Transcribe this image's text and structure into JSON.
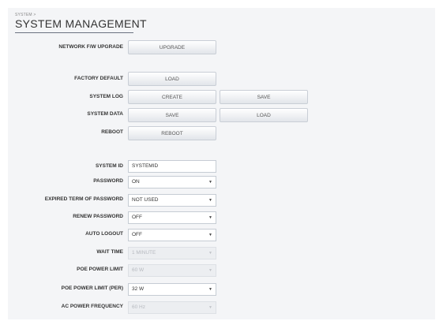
{
  "header": {
    "breadcrumb": "SYSTEM >",
    "title": "SYSTEM MANAGEMENT"
  },
  "actions": {
    "network_fw_upgrade": {
      "label": "NETWORK F/W UPGRADE",
      "button": "UPGRADE"
    },
    "factory_default": {
      "label": "FACTORY DEFAULT",
      "button": "LOAD"
    },
    "system_log": {
      "label": "SYSTEM LOG",
      "button1": "CREATE",
      "button2": "SAVE"
    },
    "system_data": {
      "label": "SYSTEM DATA",
      "button1": "SAVE",
      "button2": "LOAD"
    },
    "reboot": {
      "label": "REBOOT",
      "button": "REBOOT"
    }
  },
  "settings": {
    "system_id": {
      "label": "SYSTEM ID",
      "value": "SYSTEMID"
    },
    "password": {
      "label": "PASSWORD",
      "value": "ON"
    },
    "expired_term": {
      "label": "EXPIRED TERM OF PASSWORD",
      "value": "NOT USED"
    },
    "renew_password": {
      "label": "RENEW PASSWORD",
      "value": "OFF"
    },
    "auto_logout": {
      "label": "AUTO LOGOUT",
      "value": "OFF"
    },
    "wait_time": {
      "label": "WAIT TIME",
      "value": "1 MINUTE"
    },
    "poe_power_limit": {
      "label": "POE POWER LIMIT",
      "value": "60 W"
    },
    "poe_power_limit_port": {
      "label": "POE POWER LIMIT (PER)",
      "value": "32 W"
    },
    "ac_power_frequency": {
      "label": "AC POWER FREQUENCY",
      "value": "60 Hz"
    }
  },
  "icons": {
    "dropdown": "chevron-down-icon"
  },
  "colors": {
    "panel_bg": "#f4f5f7",
    "button_bg": "#e2e5ea",
    "header_rule": "#6a7180",
    "disabled_text": "#b6b9bf"
  }
}
